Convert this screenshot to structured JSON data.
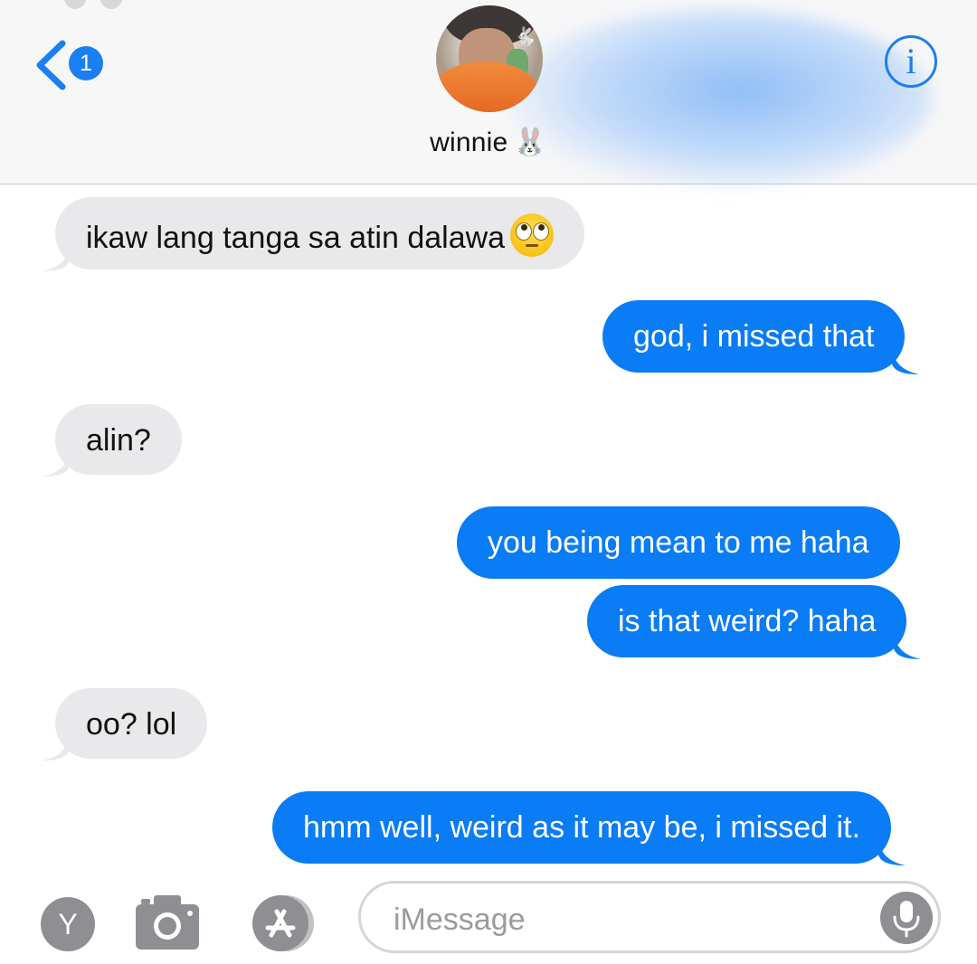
{
  "header": {
    "back_badge_count": "1",
    "contact_name": "winnie",
    "contact_emoji": "🐰",
    "info_glyph": "i"
  },
  "messages": [
    {
      "direction": "incoming",
      "text": "ikaw lang tanga sa atin dalawa",
      "emoji": "face-with-rolling-eyes"
    },
    {
      "direction": "outgoing",
      "text": "god, i missed that"
    },
    {
      "direction": "incoming",
      "text": "alin?"
    },
    {
      "direction": "outgoing",
      "text": "you being mean to me haha"
    },
    {
      "direction": "outgoing",
      "text": "is that weird? haha"
    },
    {
      "direction": "incoming",
      "text": "oo? lol"
    },
    {
      "direction": "outgoing",
      "text": "hmm well, weird as it may be, i missed it."
    }
  ],
  "input_bar": {
    "apps_button_label": "Y",
    "placeholder": "iMessage"
  },
  "icons": {
    "back": "chevron-left-icon",
    "info": "info-icon",
    "camera": "camera-icon",
    "app_store": "app-store-icon",
    "mic": "microphone-icon"
  },
  "colors": {
    "accent": "#0a7cf6",
    "incoming_bubble": "#e9e9eb",
    "header_bg": "#f7f7f8",
    "icon_gray": "#8e8e93"
  }
}
